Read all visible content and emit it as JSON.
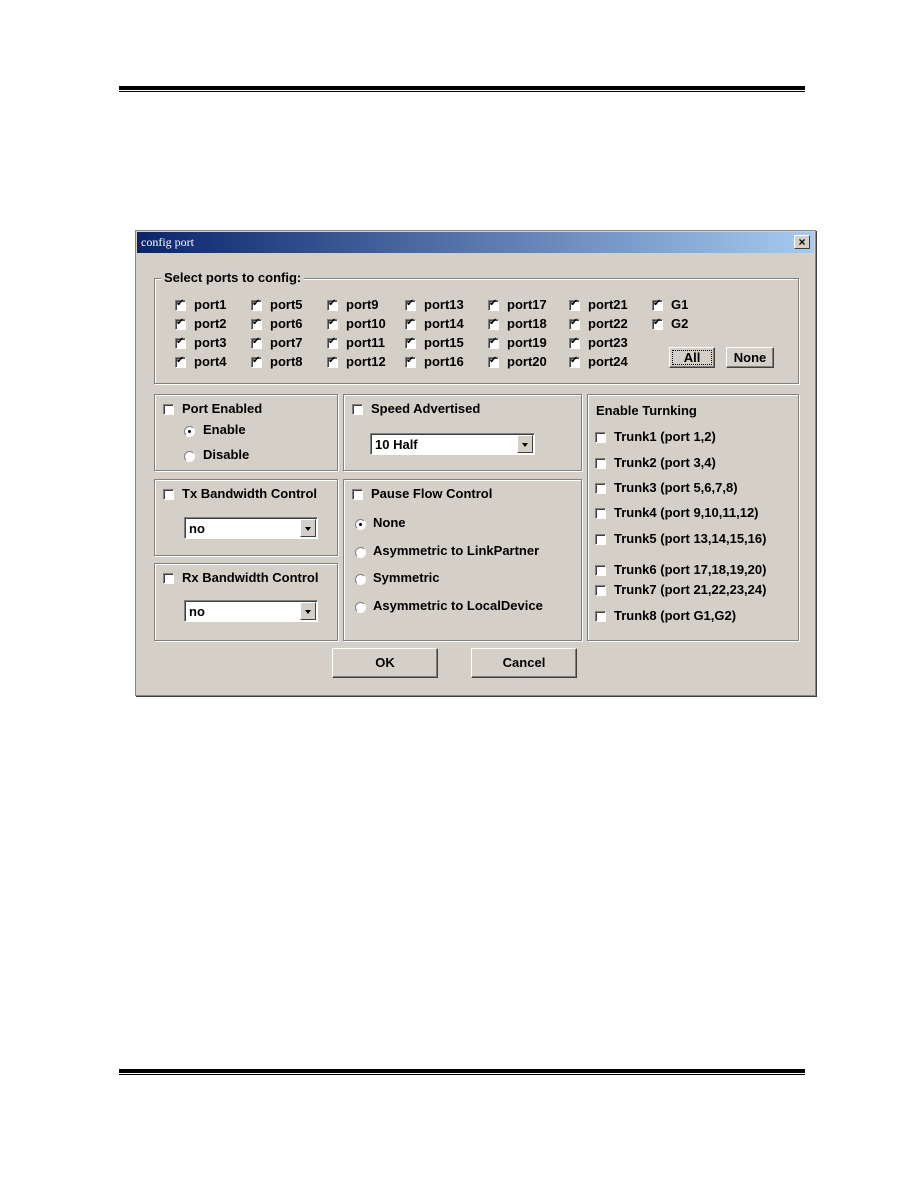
{
  "window": {
    "title": "config port",
    "close_label": "×"
  },
  "select_ports": {
    "legend": "Select ports to config:",
    "columns": [
      [
        {
          "label": "port1",
          "checked": true
        },
        {
          "label": "port2",
          "checked": true
        },
        {
          "label": "port3",
          "checked": true
        },
        {
          "label": "port4",
          "checked": true
        }
      ],
      [
        {
          "label": "port5",
          "checked": true
        },
        {
          "label": "port6",
          "checked": true
        },
        {
          "label": "port7",
          "checked": true
        },
        {
          "label": "port8",
          "checked": true
        }
      ],
      [
        {
          "label": "port9",
          "checked": true
        },
        {
          "label": "port10",
          "checked": true
        },
        {
          "label": "port11",
          "checked": true
        },
        {
          "label": "port12",
          "checked": true
        }
      ],
      [
        {
          "label": "port13",
          "checked": true
        },
        {
          "label": "port14",
          "checked": true
        },
        {
          "label": "port15",
          "checked": true
        },
        {
          "label": "port16",
          "checked": true
        }
      ],
      [
        {
          "label": "port17",
          "checked": true
        },
        {
          "label": "port18",
          "checked": true
        },
        {
          "label": "port19",
          "checked": true
        },
        {
          "label": "port20",
          "checked": true
        }
      ],
      [
        {
          "label": "port21",
          "checked": true
        },
        {
          "label": "port22",
          "checked": true
        },
        {
          "label": "port23",
          "checked": true
        },
        {
          "label": "port24",
          "checked": true
        }
      ],
      [
        {
          "label": "G1",
          "checked": true
        },
        {
          "label": "G2",
          "checked": true
        }
      ]
    ],
    "all_label": "All",
    "none_label": "None"
  },
  "port_enabled": {
    "label": "Port Enabled",
    "checked": false,
    "options": [
      {
        "label": "Enable",
        "selected": true
      },
      {
        "label": "Disable",
        "selected": false
      }
    ]
  },
  "speed_advertised": {
    "label": "Speed Advertised",
    "checked": false,
    "value": "10 Half"
  },
  "tx_bandwidth": {
    "label": "Tx Bandwidth Control",
    "checked": false,
    "value": "no"
  },
  "rx_bandwidth": {
    "label": "Rx Bandwidth Control",
    "checked": false,
    "value": "no"
  },
  "pause_flow": {
    "label": "Pause Flow Control",
    "checked": false,
    "options": [
      {
        "label": "None",
        "selected": true
      },
      {
        "label": "Asymmetric to LinkPartner",
        "selected": false
      },
      {
        "label": "Symmetric",
        "selected": false
      },
      {
        "label": "Asymmetric to LocalDevice",
        "selected": false
      }
    ]
  },
  "trunking": {
    "title": "Enable  Turnking",
    "items": [
      {
        "label": "Trunk1 (port 1,2)",
        "checked": false
      },
      {
        "label": "Trunk2 (port 3,4)",
        "checked": false
      },
      {
        "label": "Trunk3 (port 5,6,7,8)",
        "checked": false
      },
      {
        "label": "Trunk4 (port 9,10,11,12)",
        "checked": false
      },
      {
        "label": "Trunk5 (port 13,14,15,16)",
        "checked": false
      },
      {
        "label": "Trunk6 (port 17,18,19,20)",
        "checked": false
      },
      {
        "label": "Trunk7 (port 21,22,23,24)",
        "checked": false
      },
      {
        "label": "Trunk8 (port G1,G2)",
        "checked": false
      }
    ]
  },
  "buttons": {
    "ok": "OK",
    "cancel": "Cancel"
  }
}
